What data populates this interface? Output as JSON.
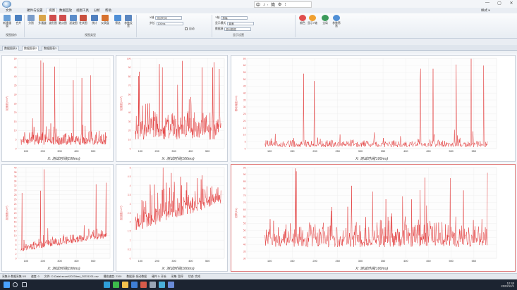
{
  "menu": [
    "文件",
    "硬件与设置",
    "视图",
    "数据回放",
    "视图工具",
    "分析",
    "帮助"
  ],
  "active_menu": "视图",
  "ime": [
    "中",
    "♪",
    "ᡃ",
    "简",
    "⚙",
    "⁝"
  ],
  "window_controls": [
    "—",
    "▢",
    "✕"
  ],
  "style_label": "样式 ▾",
  "ribbon": {
    "buttons": [
      {
        "label": "新建通道",
        "icon": "new-channel-icon",
        "color": "#6aa0d8"
      },
      {
        "label": "合并",
        "icon": "merge-icon",
        "color": "#4a7fc0"
      },
      {
        "label": "分割",
        "icon": "split-icon",
        "color": "#7a9cc9"
      },
      {
        "label": "多通道",
        "icon": "multi-channel-icon",
        "color": "#d9a54b"
      },
      {
        "label": "波形图",
        "icon": "waveform-icon",
        "color": "#d04d4d"
      },
      {
        "label": "散点图",
        "icon": "scatter-icon",
        "color": "#d04d4d"
      },
      {
        "label": "滤波图",
        "icon": "filter-chart-icon",
        "color": "#5b8cc9"
      },
      {
        "label": "柱状图",
        "icon": "bar-chart-icon",
        "color": "#c9503e"
      },
      {
        "label": "统计",
        "icon": "stats-icon",
        "color": "#4f7fbf"
      },
      {
        "label": "仪表盘",
        "icon": "gauge-icon",
        "color": "#d7722f"
      },
      {
        "label": "筛选",
        "icon": "filter-icon",
        "color": "#4f8fd6"
      },
      {
        "label": "参数设置",
        "icon": "param-settings-icon",
        "color": "#5a86c0"
      }
    ],
    "group_labels": [
      "视图操作",
      "视图类型",
      "显示设置"
    ],
    "fields": [
      {
        "label": "X轴",
        "value": "测试时间"
      },
      {
        "label": "步长",
        "value": "100ms"
      },
      {
        "label": "Y轴",
        "value": "振幅"
      },
      {
        "label": "显示模式",
        "value": "普通"
      },
      {
        "label": "数据源",
        "value": "振动数据"
      }
    ],
    "checkbox_label": "自动",
    "right_buttons": [
      {
        "label": "颜色",
        "icon": "color-icon",
        "color": "#e04d4d"
      },
      {
        "label": "显示Y轴",
        "icon": "y-axis-icon",
        "color": "#f0a030"
      },
      {
        "label": "全局",
        "icon": "global-icon",
        "color": "#3b9a5a"
      },
      {
        "label": "参数筛选",
        "icon": "param-filter-icon",
        "color": "#4f8fd6"
      }
    ]
  },
  "doc_tabs": [
    "数据图表1",
    "数据图表2",
    "数据图表3"
  ],
  "active_doc_tab": 1,
  "charts": [
    {
      "ylabel": "加速度(m/s²)",
      "ymax": 50,
      "xlabel": "X: 测试时间(100ms)",
      "xticks": [
        100,
        200,
        300,
        400,
        500
      ],
      "xmin": 50,
      "xmax": 600,
      "yticks": [
        0,
        5,
        10,
        15,
        20,
        25,
        30,
        35,
        40,
        45,
        50
      ],
      "base": 2,
      "amp": 8,
      "spikes": 6,
      "seed": 3
    },
    {
      "ylabel": "加速度(m/s²)",
      "ymax": 100,
      "xlabel": "X: 测试时间(100ms)",
      "xticks": [
        100,
        200,
        300,
        400,
        500
      ],
      "xmin": 50,
      "xmax": 600,
      "yticks": [
        0,
        10,
        20,
        30,
        40,
        50,
        60,
        70,
        80,
        90,
        100
      ],
      "base": 10,
      "amp": 35,
      "spikes": 12,
      "seed": 7
    },
    {
      "ylabel": "振动幅度(mm)",
      "ymax": 65,
      "xlabel": "X: 测试时间(100ms)",
      "xticks": [
        100,
        150,
        200,
        250,
        300,
        350,
        400,
        450,
        500,
        550
      ],
      "xmin": 50,
      "xmax": 600,
      "yticks": [
        0,
        5,
        10,
        15,
        20,
        25,
        30,
        35,
        40,
        45,
        50,
        55,
        60,
        65
      ],
      "base": 1,
      "amp": 6,
      "spikes": 8,
      "seed": 11
    },
    {
      "ylabel": "加速度(m/s²)",
      "ymax": 40,
      "xlabel": "X: 测试时间(100ms)",
      "xticks": [
        100,
        200,
        300,
        400,
        500
      ],
      "xmin": 50,
      "xmax": 600,
      "yticks": [
        0,
        2,
        4,
        6,
        8,
        10,
        12,
        14,
        16,
        18,
        20,
        22,
        24,
        26,
        28,
        30,
        32,
        34,
        36,
        38,
        40
      ],
      "base": 3,
      "amp": 4,
      "spikes": 5,
      "seed": 13,
      "trend": 6
    },
    {
      "ylabel": "加速度(m/s²)",
      "ymax": 5,
      "xlabel": "X: 测试时间(100ms)",
      "xticks": [
        100,
        200,
        300,
        400,
        500
      ],
      "xmin": 50,
      "xmax": 600,
      "yticks": [
        0,
        0.5,
        1,
        1.5,
        2,
        2.5,
        3,
        3.5,
        4,
        4.5,
        5
      ],
      "base": 1.5,
      "amp": 1.2,
      "spikes": 6,
      "seed": 17,
      "trend": 1.5
    },
    {
      "ylabel": "频率(Hz)",
      "ymax": 95,
      "ymin": 30,
      "xlabel": "X: 测试时间(100ms)",
      "xticks": [
        100,
        150,
        200,
        250,
        300,
        350,
        400,
        450,
        500,
        550
      ],
      "xmin": 50,
      "xmax": 600,
      "yticks": [
        30,
        35,
        40,
        45,
        50,
        55,
        60,
        65,
        70,
        75,
        80,
        85,
        90,
        95
      ],
      "base": 38,
      "amp": 20,
      "spikes": 8,
      "seed": 19
    }
  ],
  "status": [
    "采集卡:数据采集 0/0",
    "速度: 0",
    "文件: C:\\Data\\record\\2023\\test_20231201.csv",
    "播放速度: 2100",
    "数据源: 振动数据",
    "硬件 0: 开始",
    "采集: 暂停",
    "状态: 完成"
  ],
  "taskbar_icons": [
    {
      "icon": "start-icon",
      "color": "#4aa3ff"
    },
    {
      "icon": "search-icon",
      "color": "#cfd6e0"
    },
    {
      "icon": "taskview-icon",
      "color": "#cfd6e0"
    },
    {
      "icon": "edge-icon",
      "color": "#2f9fd8"
    },
    {
      "icon": "wechat-icon",
      "color": "#3dbb4b"
    },
    {
      "icon": "folder-icon",
      "color": "#f2c14e"
    },
    {
      "icon": "store-icon",
      "color": "#3f7fd6"
    },
    {
      "icon": "app-icon",
      "color": "#d65b4a"
    },
    {
      "icon": "settings-icon",
      "color": "#9aa6b5"
    },
    {
      "icon": "app2-icon",
      "color": "#4ab0d9"
    },
    {
      "icon": "app3-icon",
      "color": "#6a8cd8"
    }
  ],
  "tray": {
    "time": "10:48",
    "date": "2023/12/1"
  }
}
